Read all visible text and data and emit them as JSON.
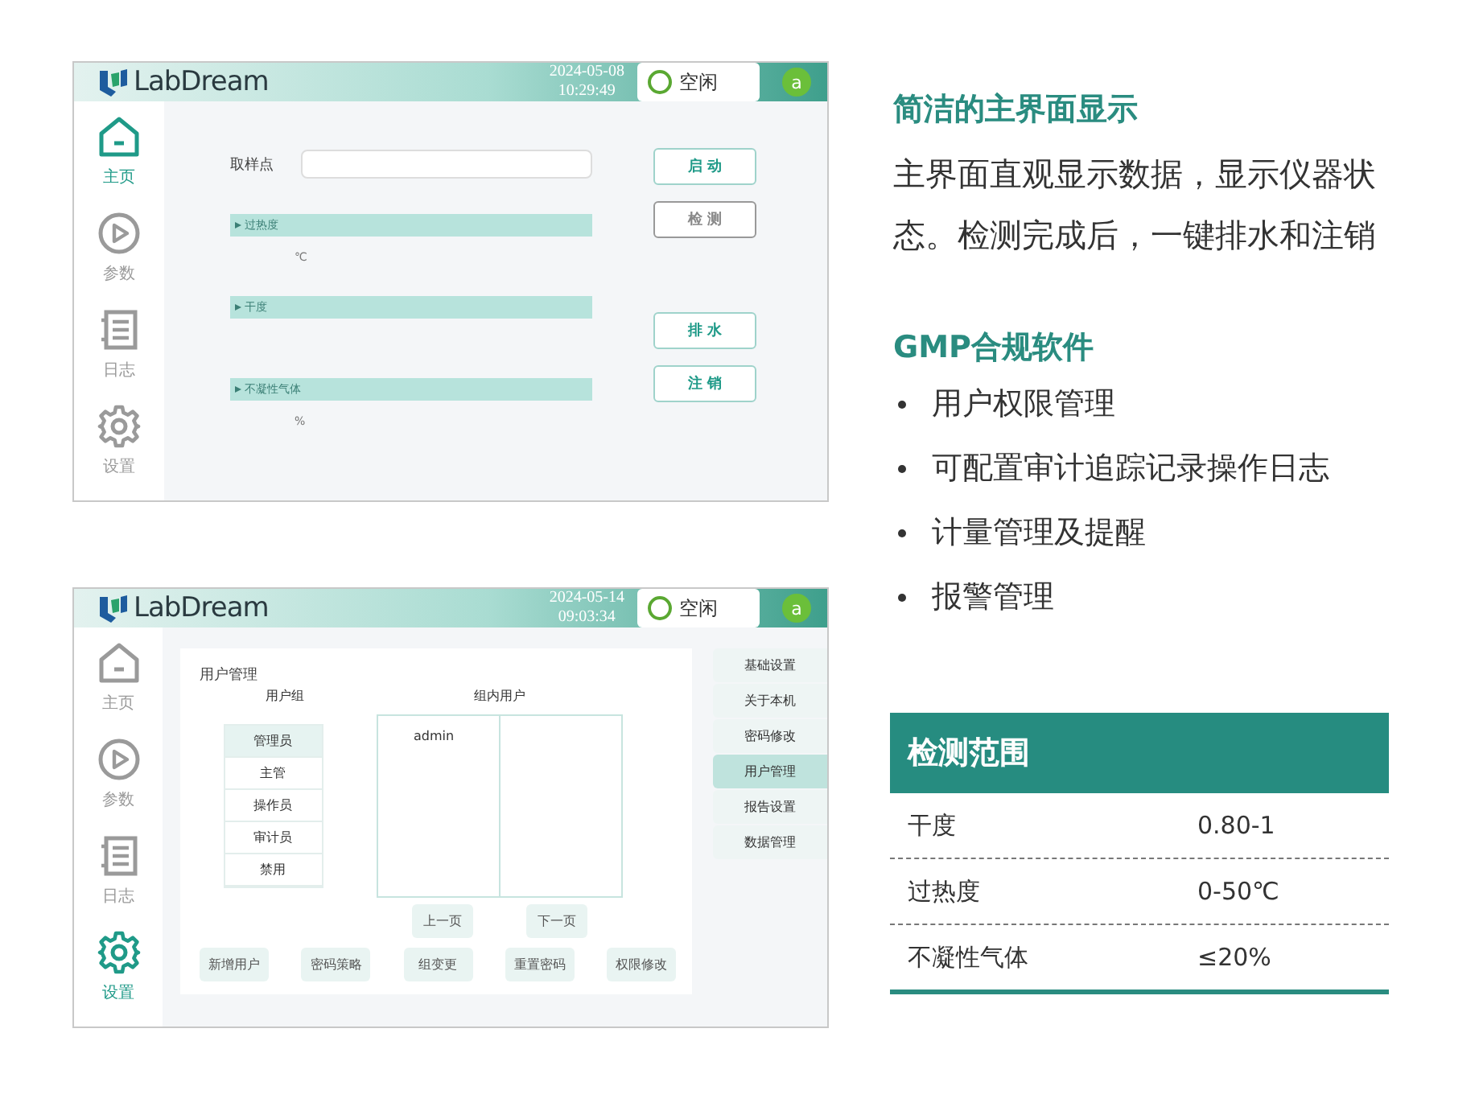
{
  "screens": [
    {
      "kind": "home",
      "header": {
        "logo": "LabDream",
        "date": "2024-05-08",
        "time": "10:29:49",
        "status": "空闲",
        "avatar": "a"
      },
      "nav": [
        {
          "label": "主页",
          "selected": true
        },
        {
          "label": "参数",
          "selected": false
        },
        {
          "label": "日志",
          "selected": false
        },
        {
          "label": "设置",
          "selected": false
        }
      ],
      "sample_label": "取样点",
      "sections": [
        {
          "title": "过热度",
          "unit": "℃"
        },
        {
          "title": "干度"
        },
        {
          "title": "不凝性气体",
          "unit": "%"
        }
      ],
      "buttons": [
        {
          "label": "启 动",
          "disabled": false
        },
        {
          "label": "检 测",
          "disabled": true
        },
        {
          "label": "排 水",
          "disabled": false
        },
        {
          "label": "注 销",
          "disabled": false
        }
      ]
    },
    {
      "kind": "settings",
      "header": {
        "logo": "LabDream",
        "date": "2024-05-14",
        "time": "09:03:34",
        "status": "空闲",
        "avatar": "a"
      },
      "nav": [
        {
          "label": "主页",
          "selected": false
        },
        {
          "label": "参数",
          "selected": false
        },
        {
          "label": "日志",
          "selected": false
        },
        {
          "label": "设置",
          "selected": true
        }
      ],
      "panel_title": "用户管理",
      "group_heading": "用户组",
      "members_heading": "组内用户",
      "groups": [
        {
          "label": "管理员",
          "selected": true
        },
        {
          "label": "主管",
          "selected": false
        },
        {
          "label": "操作员",
          "selected": false
        },
        {
          "label": "审计员",
          "selected": false
        },
        {
          "label": "禁用",
          "selected": false
        }
      ],
      "members": [
        "admin"
      ],
      "pager": [
        "上一页",
        "下一页"
      ],
      "actions": [
        "新增用户",
        "密码策略",
        "组变更",
        "重置密码",
        "权限修改"
      ],
      "menu": [
        {
          "label": "基础设置",
          "selected": false
        },
        {
          "label": "关于本机",
          "selected": false
        },
        {
          "label": "密码修改",
          "selected": false
        },
        {
          "label": "用户管理",
          "selected": true
        },
        {
          "label": "报告设置",
          "selected": false
        },
        {
          "label": "数据管理",
          "selected": false
        }
      ]
    }
  ],
  "feature": {
    "title": "简洁的主界面显示",
    "text": "主界面直观显示数据，显示仪器状态。检测完成后，一键排水和注销"
  },
  "gmp": {
    "title": "GMP合规软件",
    "items": [
      "用户权限管理",
      "可配置审计追踪记录操作日志",
      "计量管理及提醒",
      "报警管理"
    ]
  },
  "range_table": {
    "title": "检测范围",
    "rows": [
      {
        "name": "干度",
        "value": "0.80-1"
      },
      {
        "name": "过热度",
        "value": "0-50℃"
      },
      {
        "name": "不凝性气体",
        "value": "≤20%"
      }
    ]
  }
}
